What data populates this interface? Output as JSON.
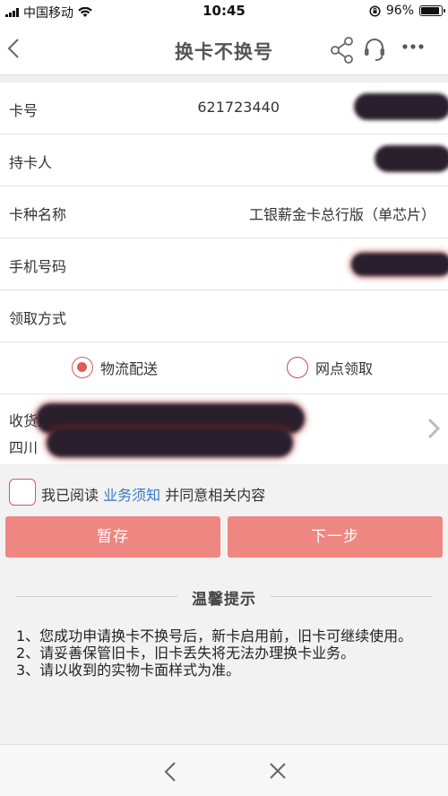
{
  "status_bar": {
    "carrier": "中国移动",
    "time": "10:45",
    "battery": "96%"
  },
  "navbar": {
    "title": "换卡不换号",
    "icons": [
      "back-icon",
      "share-icon",
      "headset-icon",
      "more-icon"
    ]
  },
  "form": {
    "card_no": {
      "label": "卡号",
      "value": "621723440"
    },
    "holder": {
      "label": "持卡人",
      "value": ""
    },
    "card_type": {
      "label": "卡种名称",
      "value": "工银薪金卡总行版（单芯片）"
    },
    "phone": {
      "label": "手机号码",
      "value": ""
    },
    "pickup": {
      "label": "领取方式"
    }
  },
  "pickup_options": {
    "logistics": {
      "label": "物流配送",
      "selected": true
    },
    "branch": {
      "label": "网点领取",
      "selected": false
    }
  },
  "address": {
    "recipient_label": "收货人：",
    "province": "四川"
  },
  "agreement": {
    "prefix": "我已阅读",
    "link": "业务须知",
    "suffix": "并同意相关内容"
  },
  "buttons": {
    "save_label": "暂存",
    "next_label": "下一步"
  },
  "tips": {
    "title": "温馨提示",
    "items": [
      "1、您成功申请换卡不换号后，新卡启用前，旧卡可继续使用。",
      "2、请妥善保管旧卡，旧卡丢失将无法办理换卡业务。",
      "3、请以收到的实物卡面样式为准。"
    ]
  },
  "colors": {
    "accent": "#ee8682",
    "link": "#3a78c3",
    "radio_on": "#e05a5a"
  }
}
